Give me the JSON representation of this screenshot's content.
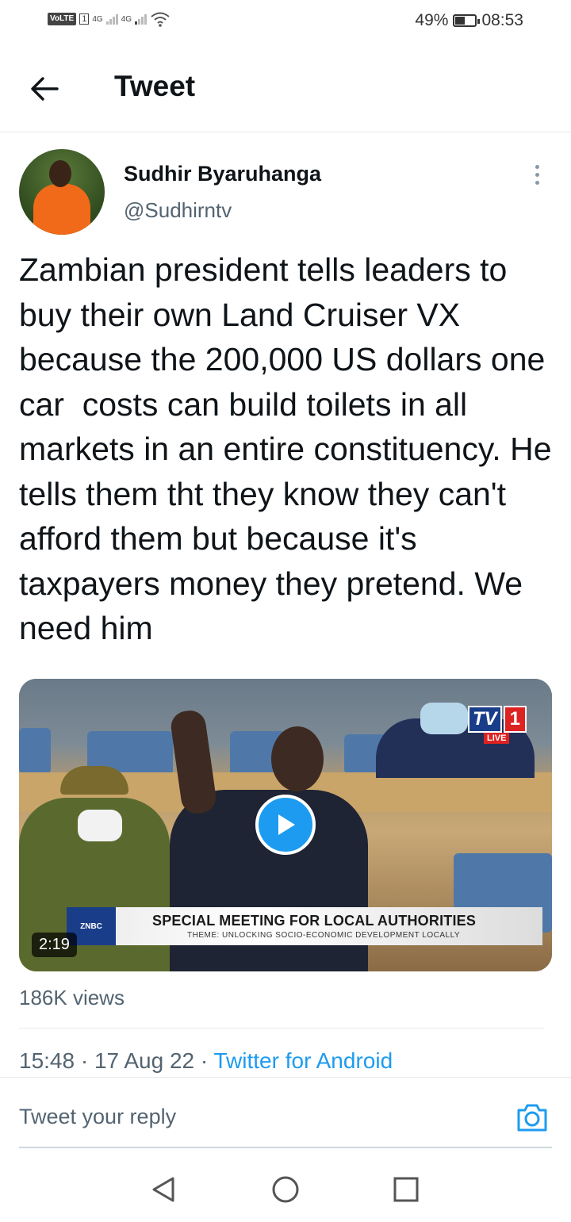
{
  "status_bar": {
    "volte": "VoLTE",
    "sim": "1",
    "network1": "4G",
    "network2": "4G",
    "battery_percent": "49%",
    "battery_level": 0.49,
    "time": "08:53"
  },
  "header": {
    "title": "Tweet",
    "back_icon": "arrow-left-icon"
  },
  "tweet": {
    "author_name": "Sudhir Byaruhanga",
    "author_handle": "@Sudhirntv",
    "text": "Zambian president tells leaders to buy their own Land Cruiser VX because the 200,000 US dollars one car  costs can build toilets in all markets in an entire constituency. He tells them tht they know they can't afford them but because it's taxpayers money they pretend. We need him",
    "media": {
      "channel_logo": "TV",
      "channel_number": "1",
      "live_label": "LIVE",
      "broadcaster": "ZNBC",
      "caption_title": "SPECIAL MEETING FOR LOCAL AUTHORITIES",
      "caption_subtitle": "THEME: UNLOCKING SOCIO-ECONOMIC DEVELOPMENT LOCALLY",
      "duration": "2:19"
    },
    "views": "186K views",
    "time": "15:48",
    "date": "17 Aug 22",
    "client": "Twitter for Android"
  },
  "reply": {
    "placeholder": "Tweet your reply"
  },
  "colors": {
    "accent": "#1d9bf0",
    "secondary_text": "#536471",
    "primary_text": "#0f1419"
  }
}
